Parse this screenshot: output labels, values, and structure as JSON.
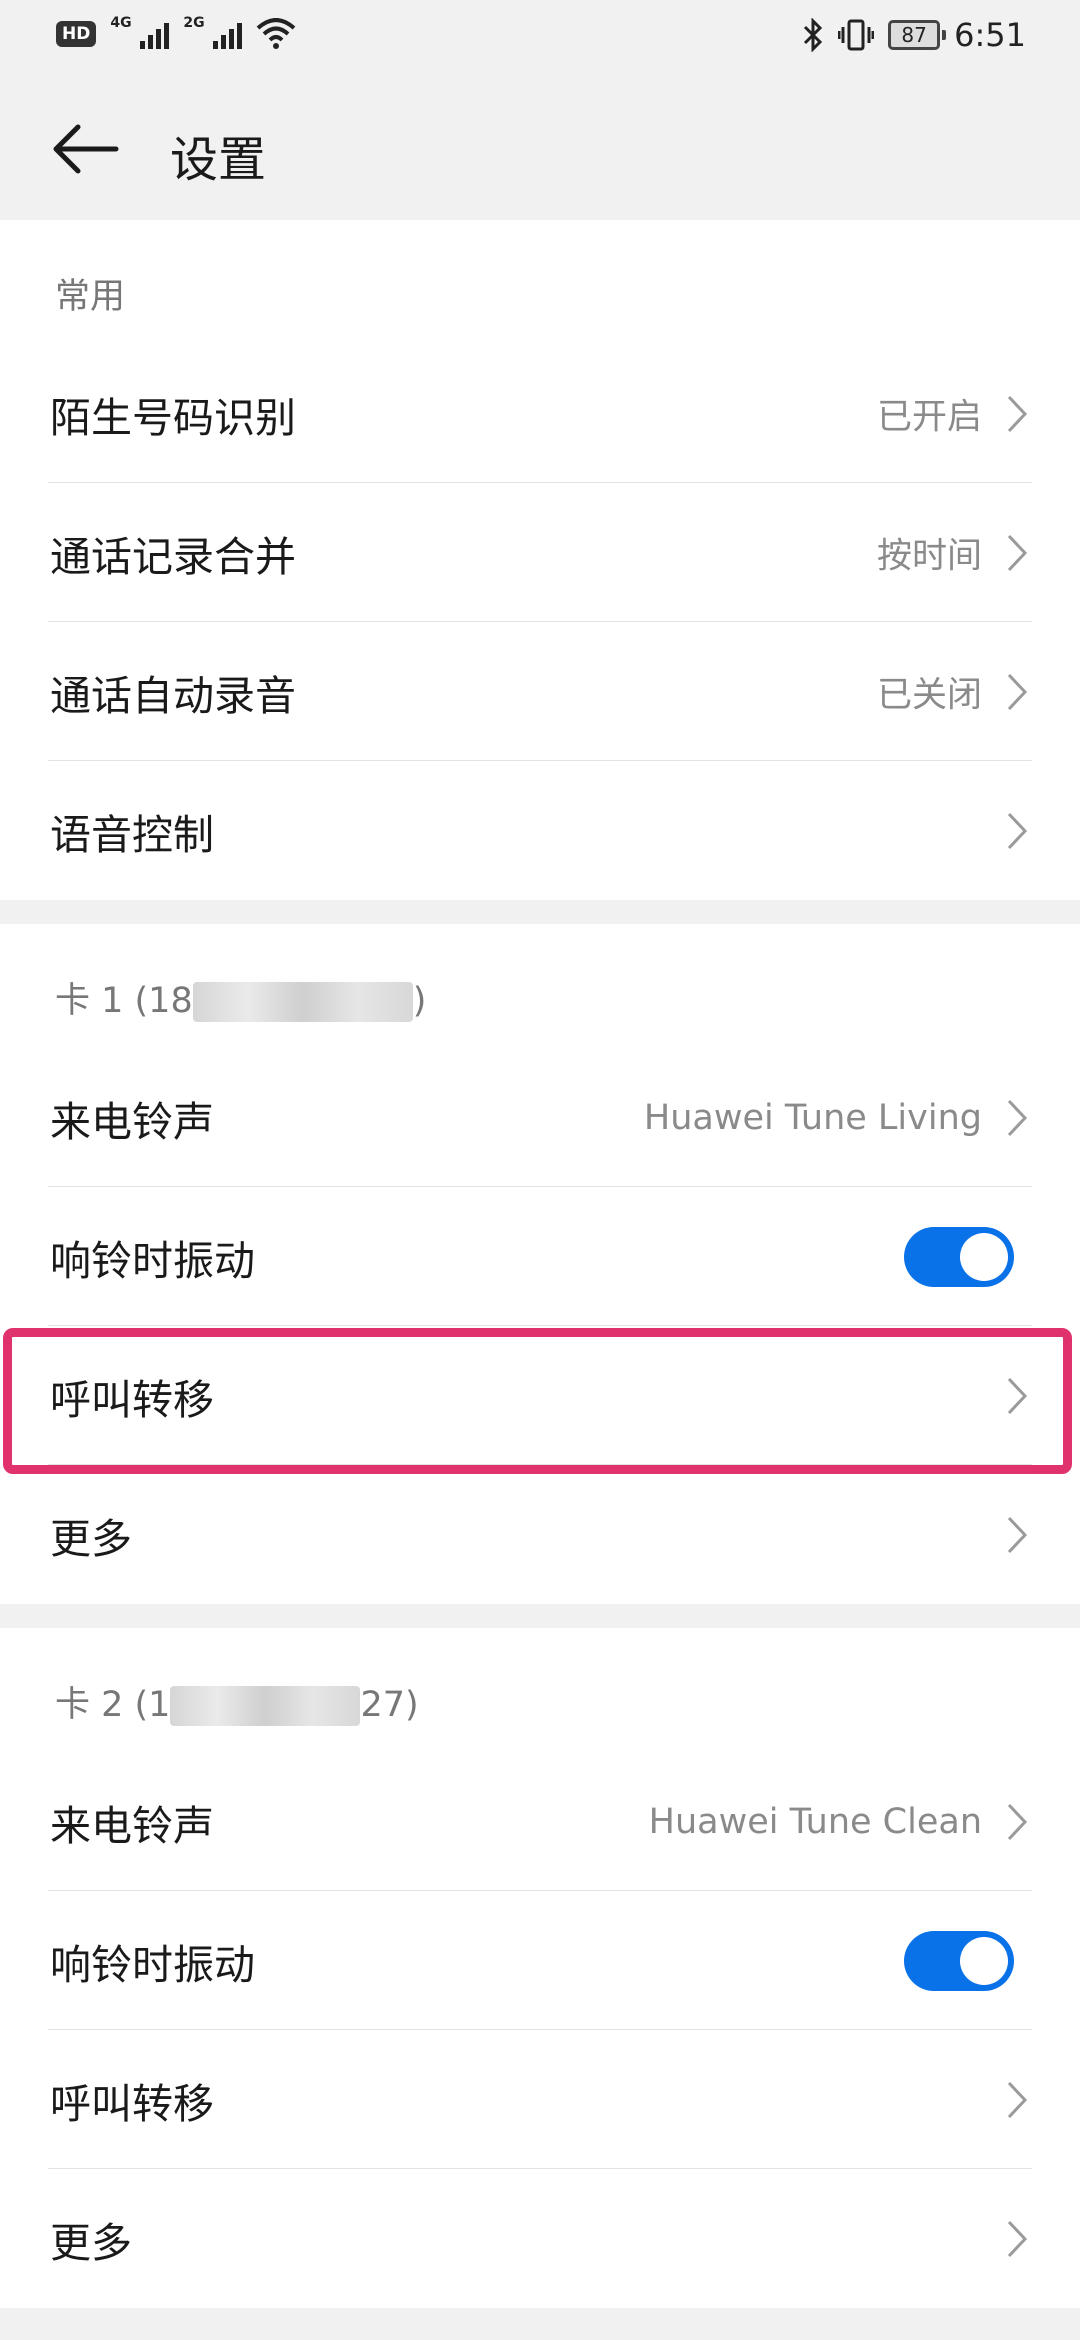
{
  "status_bar": {
    "hd": "HD",
    "sim1_gen": "4G",
    "sim2_gen": "2G",
    "battery": "87",
    "time": "6:51"
  },
  "app_bar": {
    "title": "设置"
  },
  "section_common": {
    "title": "常用",
    "rows": [
      {
        "label": "陌生号码识别",
        "value": "已开启"
      },
      {
        "label": "通话记录合并",
        "value": "按时间"
      },
      {
        "label": "通话自动录音",
        "value": "已关闭"
      },
      {
        "label": "语音控制",
        "value": ""
      }
    ]
  },
  "section_sim1": {
    "title_prefix": "卡 1 (18",
    "title_suffix": ")",
    "ringtone_label": "来电铃声",
    "ringtone_value": "Huawei Tune Living",
    "vibrate_label": "响铃时振动",
    "vibrate_on": true,
    "forward_label": "呼叫转移",
    "more_label": "更多"
  },
  "section_sim2": {
    "title_prefix": "卡 2 (1",
    "title_suffix": "27)",
    "ringtone_label": "来电铃声",
    "ringtone_value": "Huawei Tune Clean",
    "vibrate_label": "响铃时振动",
    "vibrate_on": true,
    "forward_label": "呼叫转移",
    "more_label": "更多"
  },
  "colors": {
    "accent": "#0a72e8",
    "highlight": "#e0336e"
  }
}
